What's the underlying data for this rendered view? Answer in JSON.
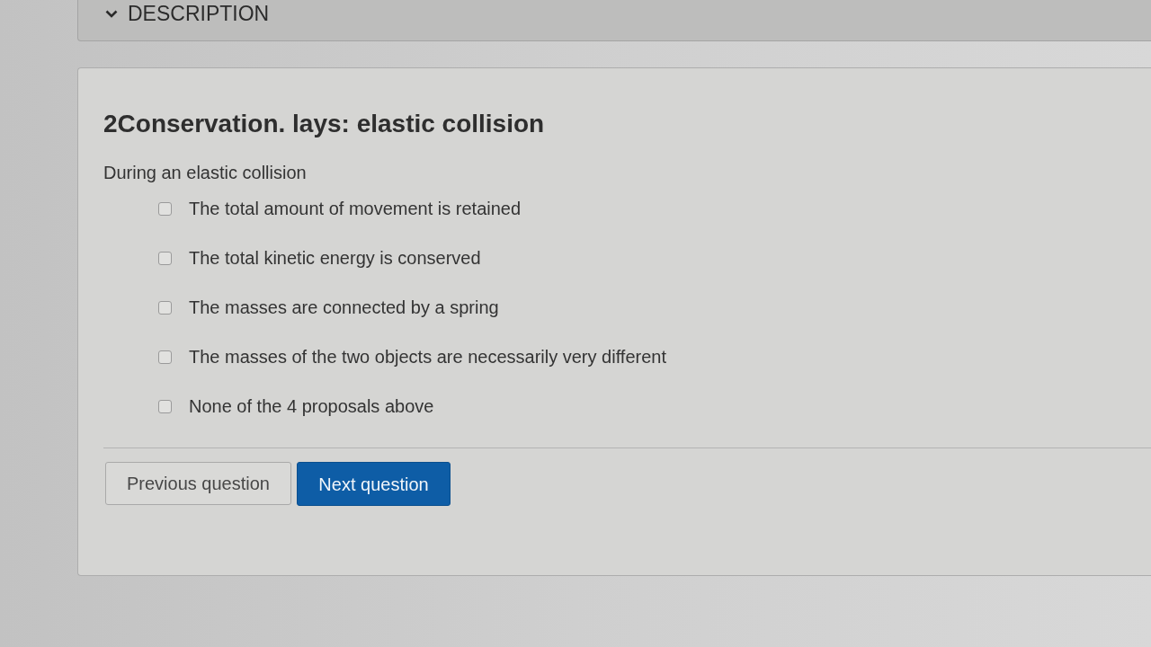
{
  "description_toggle": {
    "label": "DESCRIPTION"
  },
  "question": {
    "title": "2Conservation. lays: elastic collision",
    "prompt": "During an elastic collision",
    "options": [
      {
        "label": "The total amount of movement is retained",
        "checked": false
      },
      {
        "label": "The total kinetic energy is conserved",
        "checked": false
      },
      {
        "label": "The masses are connected by a spring",
        "checked": false
      },
      {
        "label": "The masses of the two objects are necessarily very different",
        "checked": false
      },
      {
        "label": "None of the 4 proposals above",
        "checked": false
      }
    ]
  },
  "navigation": {
    "buttons": [
      {
        "label": "Previous question",
        "kind": "secondary"
      },
      {
        "label": "Next question",
        "kind": "primary"
      }
    ]
  }
}
